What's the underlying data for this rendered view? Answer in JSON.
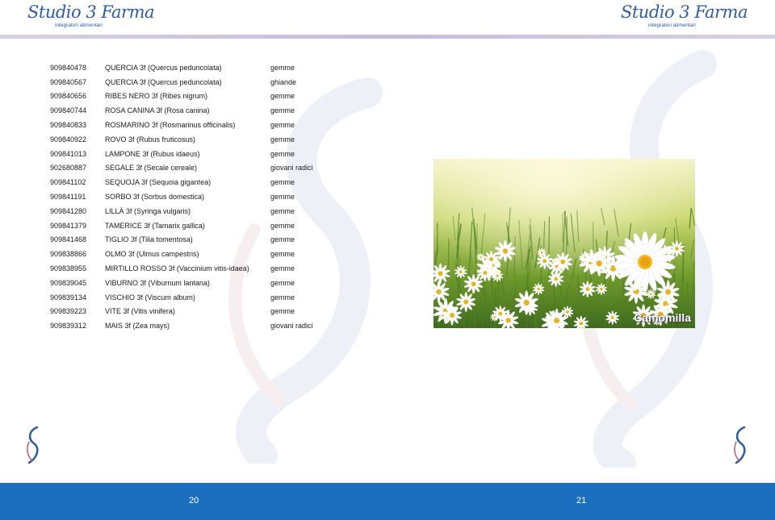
{
  "header": {
    "brand": "Studio 3 Farma",
    "tagline": "integratori alimentari"
  },
  "table": {
    "rows": [
      {
        "code": "909840478",
        "name": "QUERCIA 3f (Quercus peduncolata)",
        "type": "gemme"
      },
      {
        "code": "909840567",
        "name": "QUERCIA 3f (Quercus peduncolata)",
        "type": "ghiande"
      },
      {
        "code": "909840656",
        "name": "RIBES NERO 3f (Ribes nigrum)",
        "type": "gemme"
      },
      {
        "code": "909840744",
        "name": "ROSA CANINA 3f (Rosa canina)",
        "type": "gemme"
      },
      {
        "code": "909840833",
        "name": "ROSMARINO 3f (Rosmarinus officinalis)",
        "type": "gemme"
      },
      {
        "code": "909840922",
        "name": "ROVO 3f (Rubus fruticosus)",
        "type": "gemme"
      },
      {
        "code": "909841013",
        "name": "LAMPONE 3f (Rubus idaeus)",
        "type": "gemme"
      },
      {
        "code": "902680887",
        "name": "SEGALE 3f (Secale cereale)",
        "type": "giovani radici"
      },
      {
        "code": "909841102",
        "name": "SEQUOJA 3f (Sequoia gigantea)",
        "type": "gemme"
      },
      {
        "code": "909841191",
        "name": "SORBO 3f (Sorbus domestica)",
        "type": "gemme"
      },
      {
        "code": "909841280",
        "name": "LILLÀ 3f (Syringa vulgaris)",
        "type": "gemme"
      },
      {
        "code": "909841379",
        "name": "TAMERICE 3f (Tamarix gallica)",
        "type": "gemme"
      },
      {
        "code": "909841468",
        "name": "TIGLIO 3f (Tilia tomentosa)",
        "type": "gemme"
      },
      {
        "code": "909838866",
        "name": "OLMO 3f (Ulmus campestris)",
        "type": "gemme"
      },
      {
        "code": "909838955",
        "name": "MIRTILLO ROSSO 3f (Vaccinium vitis-idaea)",
        "type": "gemme"
      },
      {
        "code": "909839045",
        "name": "VIBURNO 3f (Viburnum lantana)",
        "type": "gemme"
      },
      {
        "code": "909839134",
        "name": "VISCHIO 3f (Viscum album)",
        "type": "gemme"
      },
      {
        "code": "909839223",
        "name": "VITE 3f (Vitis vinifera)",
        "type": "gemme"
      },
      {
        "code": "909839312",
        "name": "MAIS 3f (Zea mays)",
        "type": "giovani radici"
      }
    ]
  },
  "photo": {
    "caption": "Camomilla",
    "icon": "chamomile-meadow-image"
  },
  "footer": {
    "page_left": "20",
    "page_right": "21"
  },
  "colors": {
    "brand_blue": "#2d5cab",
    "footer_blue": "#1c6fbf",
    "header_line": "#c7bbdc"
  }
}
